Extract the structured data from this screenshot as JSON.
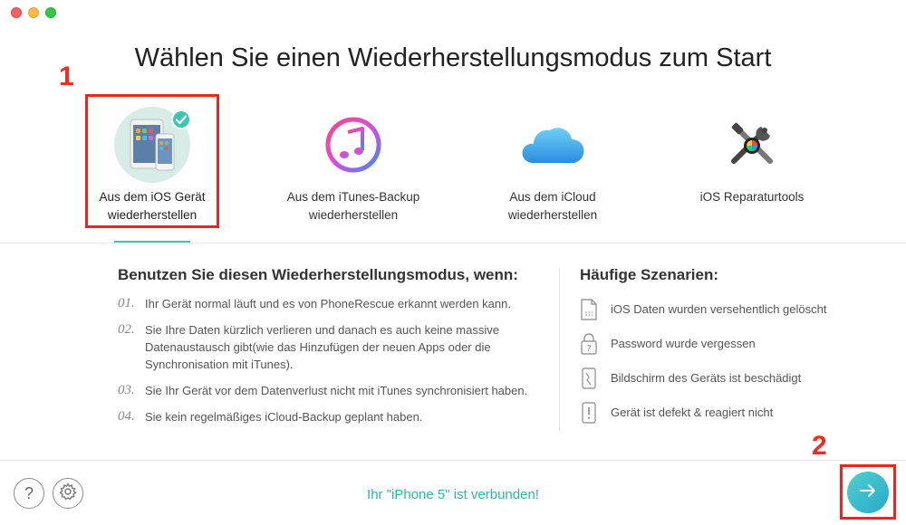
{
  "page": {
    "title": "Wählen Sie einen Wiederherstellungsmodus zum Start"
  },
  "annotations": [
    "1",
    "2"
  ],
  "modes": [
    {
      "line1": "Aus dem iOS Gerät",
      "line2": "wiederherstellen",
      "icon": "ios-devices-icon",
      "selected": true
    },
    {
      "line1": "Aus dem iTunes-Backup",
      "line2": "wiederherstellen",
      "icon": "itunes-icon",
      "selected": false
    },
    {
      "line1": "Aus dem iCloud",
      "line2": "wiederherstellen",
      "icon": "icloud-icon",
      "selected": false
    },
    {
      "line1": "iOS Reparaturtools",
      "line2": "",
      "icon": "repair-tools-icon",
      "selected": false
    }
  ],
  "usage": {
    "heading": "Benutzen Sie diesen Wiederherstellungsmodus, wenn:",
    "reasons": [
      {
        "num": "01.",
        "text": "Ihr Gerät normal läuft und es von PhoneRescue erkannt werden kann."
      },
      {
        "num": "02.",
        "text": "Sie Ihre Daten kürzlich verlieren und danach es auch keine massive Datenaustausch gibt(wie das Hinzufügen der neuen Apps oder die Synchronisation mit iTunes)."
      },
      {
        "num": "03.",
        "text": "Sie Ihr Gerät vor dem Datenverlust nicht mit iTunes synchronisiert haben."
      },
      {
        "num": "04.",
        "text": "Sie kein regelmäßiges iCloud-Backup geplant haben."
      }
    ]
  },
  "scenarios": {
    "heading": "Häufige Szenarien:",
    "items": [
      {
        "text": "iOS Daten wurden versehentlich gelöscht",
        "icon": "deleted-data-icon"
      },
      {
        "text": "Password wurde vergessen",
        "icon": "forgot-password-icon"
      },
      {
        "text": "Bildschirm des Geräts ist beschädigt",
        "icon": "broken-screen-icon"
      },
      {
        "text": "Gerät ist defekt & reagiert nicht",
        "icon": "unresponsive-device-icon"
      }
    ]
  },
  "footer": {
    "status": "Ihr \"iPhone 5\" ist verbunden!",
    "help_label": "?"
  },
  "colors": {
    "accent": "#2fb5a5",
    "annotation": "#e9261f"
  }
}
